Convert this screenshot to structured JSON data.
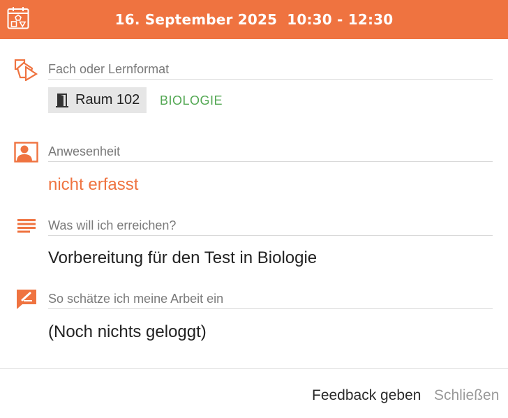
{
  "header": {
    "date": "16. September 2025",
    "time": "10:30 - 12:30",
    "icon": "calendar-shapes-icon",
    "color": "#ef7340"
  },
  "subject_section": {
    "label": "Fach oder Lernformat",
    "room": "Raum 102",
    "subject": "BIOLOGIE",
    "icon": "shapes-icon"
  },
  "attendance_section": {
    "label": "Anwesenheit",
    "value": "nicht erfasst",
    "icon": "person-card-icon"
  },
  "goal_section": {
    "label": "Was will ich erreichen?",
    "value": "Vorbereitung für den Test in Biologie",
    "icon": "text-lines-icon"
  },
  "assessment_section": {
    "label": "So schätze ich meine Arbeit ein",
    "value": "(Noch nichts geloggt)",
    "icon": "edit-comment-icon"
  },
  "footer": {
    "feedback_label": "Feedback geben",
    "close_label": "Schließen"
  },
  "colors": {
    "accent": "#ef7340",
    "subject": "#52a752",
    "attendance": "#ef7340"
  }
}
